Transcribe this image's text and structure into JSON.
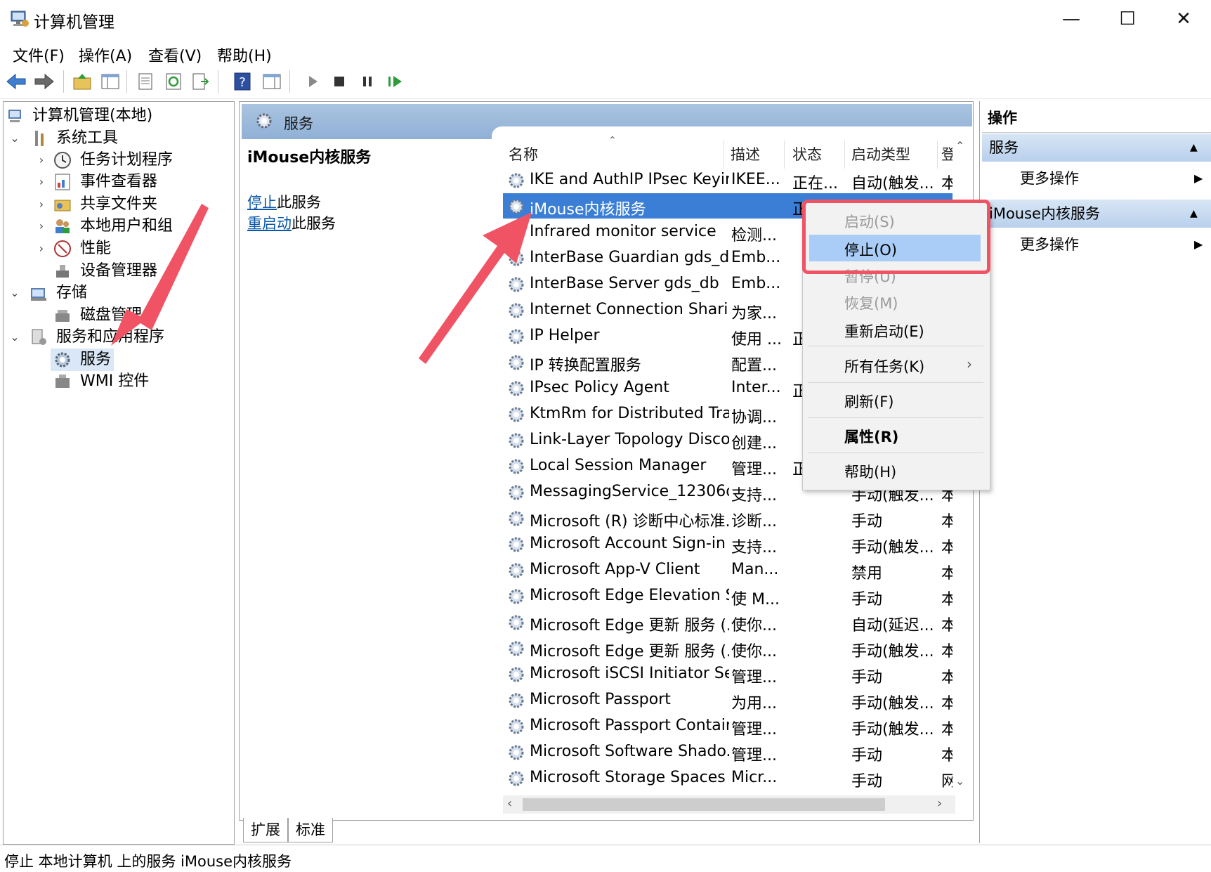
{
  "window": {
    "title": "计算机管理",
    "minimize": "—",
    "maximize": "☐",
    "close": "✕"
  },
  "menu": [
    "文件(F)",
    "操作(A)",
    "查看(V)",
    "帮助(H)"
  ],
  "tree": {
    "root": "计算机管理(本地)",
    "system_tools": "系统工具",
    "task_scheduler": "任务计划程序",
    "event_viewer": "事件查看器",
    "shared_folders": "共享文件夹",
    "local_users": "本地用户和组",
    "performance": "性能",
    "device_manager": "设备管理器",
    "storage": "存储",
    "disk_management": "磁盘管理",
    "services_apps": "服务和应用程序",
    "services": "服务",
    "wmi": "WMI 控件"
  },
  "center": {
    "header_title": "服务",
    "detail_title": "iMouse内核服务",
    "stop_link": "停止",
    "stop_suffix": "此服务",
    "restart_link": "重启动",
    "restart_suffix": "此服务",
    "columns": [
      "名称",
      "描述",
      "状态",
      "启动类型",
      "登"
    ],
    "rows": [
      {
        "name": "IKE and AuthIP IPsec Keyin...",
        "desc": "IKEE...",
        "status": "正在...",
        "startup": "自动(触发...",
        "logon": "本"
      },
      {
        "name": "iMouse内核服务",
        "desc": "",
        "status": "正",
        "startup": "",
        "logon": ""
      },
      {
        "name": "Infrared monitor service",
        "desc": "检测...",
        "status": "",
        "startup": "",
        "logon": ""
      },
      {
        "name": "InterBase Guardian gds_db",
        "desc": "Emb...",
        "status": "",
        "startup": "",
        "logon": ""
      },
      {
        "name": "InterBase Server gds_db",
        "desc": "Emb...",
        "status": "",
        "startup": "",
        "logon": ""
      },
      {
        "name": "Internet Connection Sharin...",
        "desc": "为家...",
        "status": "",
        "startup": "",
        "logon": ""
      },
      {
        "name": "IP Helper",
        "desc": "使用 ...",
        "status": "正",
        "startup": "",
        "logon": ""
      },
      {
        "name": "IP 转换配置服务",
        "desc": "配置...",
        "status": "",
        "startup": "",
        "logon": ""
      },
      {
        "name": "IPsec Policy Agent",
        "desc": "Inter...",
        "status": "正",
        "startup": "",
        "logon": ""
      },
      {
        "name": "KtmRm for Distributed Tra...",
        "desc": "协调...",
        "status": "",
        "startup": "",
        "logon": ""
      },
      {
        "name": "Link-Layer Topology Disco...",
        "desc": "创建...",
        "status": "",
        "startup": "",
        "logon": ""
      },
      {
        "name": "Local Session Manager",
        "desc": "管理...",
        "status": "正",
        "startup": "",
        "logon": ""
      },
      {
        "name": "MessagingService_12306d",
        "desc": "支持...",
        "status": "",
        "startup": "手动(触发...",
        "logon": "本"
      },
      {
        "name": "Microsoft (R) 诊断中心标准...",
        "desc": "诊断...",
        "status": "",
        "startup": "手动",
        "logon": "本"
      },
      {
        "name": "Microsoft Account Sign-in ...",
        "desc": "支持...",
        "status": "",
        "startup": "手动(触发...",
        "logon": "本"
      },
      {
        "name": "Microsoft App-V Client",
        "desc": "Man...",
        "status": "",
        "startup": "禁用",
        "logon": "本"
      },
      {
        "name": "Microsoft Edge Elevation S...",
        "desc": "使 M...",
        "status": "",
        "startup": "手动",
        "logon": "本"
      },
      {
        "name": "Microsoft Edge 更新 服务 (...",
        "desc": "使你...",
        "status": "",
        "startup": "自动(延迟...",
        "logon": "本"
      },
      {
        "name": "Microsoft Edge 更新 服务 (...",
        "desc": "使你...",
        "status": "",
        "startup": "手动(触发...",
        "logon": "本"
      },
      {
        "name": "Microsoft iSCSI Initiator Ser...",
        "desc": "管理...",
        "status": "",
        "startup": "手动",
        "logon": "本"
      },
      {
        "name": "Microsoft Passport",
        "desc": "为用...",
        "status": "",
        "startup": "手动(触发...",
        "logon": "本"
      },
      {
        "name": "Microsoft Passport Container",
        "desc": "管理...",
        "status": "",
        "startup": "手动(触发...",
        "logon": "本"
      },
      {
        "name": "Microsoft Software Shado...",
        "desc": "管理...",
        "status": "",
        "startup": "手动",
        "logon": "本"
      },
      {
        "name": "Microsoft Storage Spaces S...",
        "desc": "Micr...",
        "status": "",
        "startup": "手动",
        "logon": "网"
      }
    ]
  },
  "tabs": [
    "扩展",
    "标准"
  ],
  "actions": {
    "header": "操作",
    "section1": "服务",
    "section1_more": "更多操作",
    "section2": "iMouse内核服务",
    "section2_more": "更多操作"
  },
  "context_menu": {
    "start": "启动(S)",
    "stop": "停止(O)",
    "pause": "暂停(U)",
    "resume": "恢复(M)",
    "restart": "重新启动(E)",
    "all_tasks": "所有任务(K)",
    "refresh": "刷新(F)",
    "properties": "属性(R)",
    "help": "帮助(H)"
  },
  "status": "停止 本地计算机 上的服务 iMouse内核服务",
  "colors": {
    "selection": "#3a7fd5",
    "menu_highlight": "#a9cdf6",
    "annotation": "#f05464",
    "header": "#9db9dc",
    "link": "#0b57a8"
  }
}
